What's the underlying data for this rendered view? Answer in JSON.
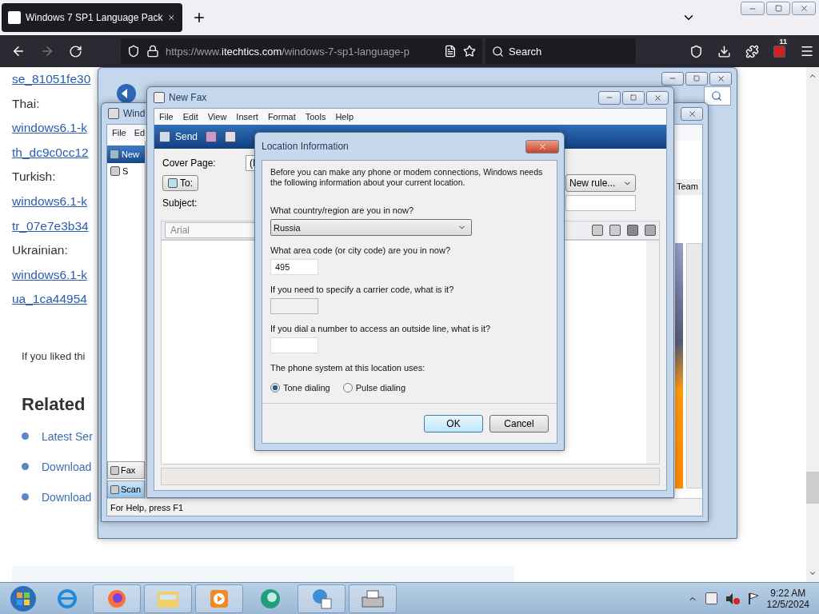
{
  "browser": {
    "tab": {
      "title": "Windows 7 SP1 Language Pack",
      "selected": true
    },
    "url_prefix": "https://www.",
    "url_domain": "itechtics.com",
    "url_path": "/windows-7-sp1-language-p",
    "search_placeholder": "Search",
    "badge": "11"
  },
  "article": {
    "lines": [
      {
        "kind": "link",
        "text": "se_81051fe30"
      },
      {
        "kind": "label",
        "text": "Thai:"
      },
      {
        "kind": "link",
        "text": "windows6.1-k"
      },
      {
        "kind": "link",
        "text": "th_dc9c0cc12"
      },
      {
        "kind": "label",
        "text": "Turkish:"
      },
      {
        "kind": "link",
        "text": "windows6.1-k"
      },
      {
        "kind": "link",
        "text": "tr_07e7e3b34"
      },
      {
        "kind": "label",
        "text": "Ukrainian:"
      },
      {
        "kind": "link",
        "text": "windows6.1-k"
      },
      {
        "kind": "link",
        "text": "ua_1ca44954"
      }
    ],
    "note": "If you liked thi",
    "heading": "Related",
    "related": [
      "Latest Ser",
      "Download",
      "Download"
    ]
  },
  "fax_scan": {
    "title": "Wind",
    "menu": [
      "File",
      "Ed"
    ],
    "new_button": "New",
    "tree_item": "S",
    "column": "Team",
    "nav": [
      {
        "label": "Fax",
        "selected": false
      },
      {
        "label": "Scan",
        "selected": true
      }
    ],
    "status": "For Help, press F1"
  },
  "new_fax": {
    "title": "New Fax",
    "menu": [
      "File",
      "Edit",
      "View",
      "Insert",
      "Format",
      "Tools",
      "Help"
    ],
    "send": "Send",
    "cover_label": "Cover Page:",
    "cover_value": "(I",
    "to_button": "To:",
    "subject_label": "Subject:",
    "rule": "New rule...",
    "font": "Arial"
  },
  "dialog": {
    "title": "Location Information",
    "intro": "Before you can make any phone or modem connections, Windows needs the following information about your current location.",
    "fields": [
      {
        "kind": "select",
        "label": "What country/region are you in now?",
        "value": "Russia",
        "disabled": false
      },
      {
        "kind": "text",
        "label": "What area code (or city code) are you in now?",
        "value": "495",
        "disabled": false
      },
      {
        "kind": "text",
        "label": "If you need to specify a carrier code, what is it?",
        "disabled": true
      },
      {
        "kind": "text",
        "label": "If you dial a number to access an outside line, what is it?",
        "disabled": false
      }
    ],
    "radio_label": "The phone system at this location uses:",
    "radios": [
      {
        "label": "Tone dialing",
        "selected": true
      },
      {
        "label": "Pulse dialing",
        "selected": false
      }
    ],
    "buttons": [
      {
        "label": "OK",
        "default": true
      },
      {
        "label": "Cancel",
        "default": false
      }
    ]
  },
  "taskbar": {
    "time": "9:22 AM",
    "date": "12/5/2024"
  }
}
